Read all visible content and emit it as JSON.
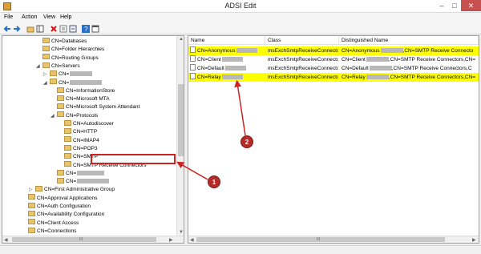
{
  "window": {
    "title": "ADSI Edit"
  },
  "menu": [
    "File",
    "Action",
    "View",
    "Help"
  ],
  "tree": [
    {
      "label": "CN=Databases",
      "indent": 4,
      "redact": 0
    },
    {
      "label": "CN=Folder Hierarchies",
      "indent": 4,
      "redact": 0
    },
    {
      "label": "CN=Routing Groups",
      "indent": 4,
      "redact": 0
    },
    {
      "label": "CN=Servers",
      "indent": 4,
      "redact": 0,
      "expander": "◢"
    },
    {
      "label": "CN=",
      "indent": 5,
      "redact": 28,
      "expander": "▷"
    },
    {
      "label": "CN=",
      "indent": 5,
      "redact": 40,
      "expander": "◢"
    },
    {
      "label": "CN=InformationStore",
      "indent": 6,
      "redact": 0
    },
    {
      "label": "CN=Microsoft MTA",
      "indent": 6,
      "redact": 0
    },
    {
      "label": "CN=Microsoft System Attendant",
      "indent": 6,
      "redact": 0
    },
    {
      "label": "CN=Protocols",
      "indent": 6,
      "redact": 0,
      "expander": "◢"
    },
    {
      "label": "CN=Autodiscover",
      "indent": 7,
      "redact": 0
    },
    {
      "label": "CN=HTTP",
      "indent": 7,
      "redact": 0
    },
    {
      "label": "CN=IMAP4",
      "indent": 7,
      "redact": 0
    },
    {
      "label": "CN=POP3",
      "indent": 7,
      "redact": 0
    },
    {
      "label": "CN=SMTP",
      "indent": 7,
      "redact": 0
    },
    {
      "label": "CN=SMTP Receive Connectors",
      "indent": 7,
      "redact": 0,
      "selected": true
    },
    {
      "label": "CN=",
      "indent": 6,
      "redact": 34
    },
    {
      "label": "CN=",
      "indent": 6,
      "redact": 40
    },
    {
      "label": "CN=First Administrative Group",
      "indent": 3,
      "redact": 0,
      "expander": "▷"
    },
    {
      "label": "CN=Approval Applications",
      "indent": 2,
      "redact": 0
    },
    {
      "label": "CN=Auth Configuration",
      "indent": 2,
      "redact": 0
    },
    {
      "label": "CN=Availability Configuration",
      "indent": 2,
      "redact": 0
    },
    {
      "label": "CN=Client Access",
      "indent": 2,
      "redact": 0
    },
    {
      "label": "CN=Connections",
      "indent": 2,
      "redact": 0
    }
  ],
  "list": {
    "columns": [
      "Name",
      "Class",
      "Distinguished Name"
    ],
    "rows": [
      {
        "name": "CN=Anonymous",
        "cls": "msExchSmtpReceiveConnector",
        "dn": "CN=Anonymous",
        "dn_tail": ",CN=SMTP Receive Connecto",
        "hl": true
      },
      {
        "name": "CN=Client",
        "cls": "msExchSmtpReceiveConnector",
        "dn": "CN=Client",
        "dn_tail": ",CN=SMTP Receive Connectors,CN=",
        "hl": false
      },
      {
        "name": "CN=Default",
        "cls": "msExchSmtpReceiveConnector",
        "dn": "CN=Default",
        "dn_tail": ",CN=SMTP Receive Connectors,C",
        "hl": false
      },
      {
        "name": "CN=Relay",
        "cls": "msExchSmtpReceiveConnector",
        "dn": "CN=Relay",
        "dn_tail": ",CN=SMTP Receive Connectors,CN=",
        "hl": true
      }
    ]
  },
  "callouts": {
    "one": "1",
    "two": "2"
  },
  "scroll": {
    "up": "▲",
    "down": "▼",
    "left": "◀",
    "right": "▶",
    "grip": "III"
  }
}
